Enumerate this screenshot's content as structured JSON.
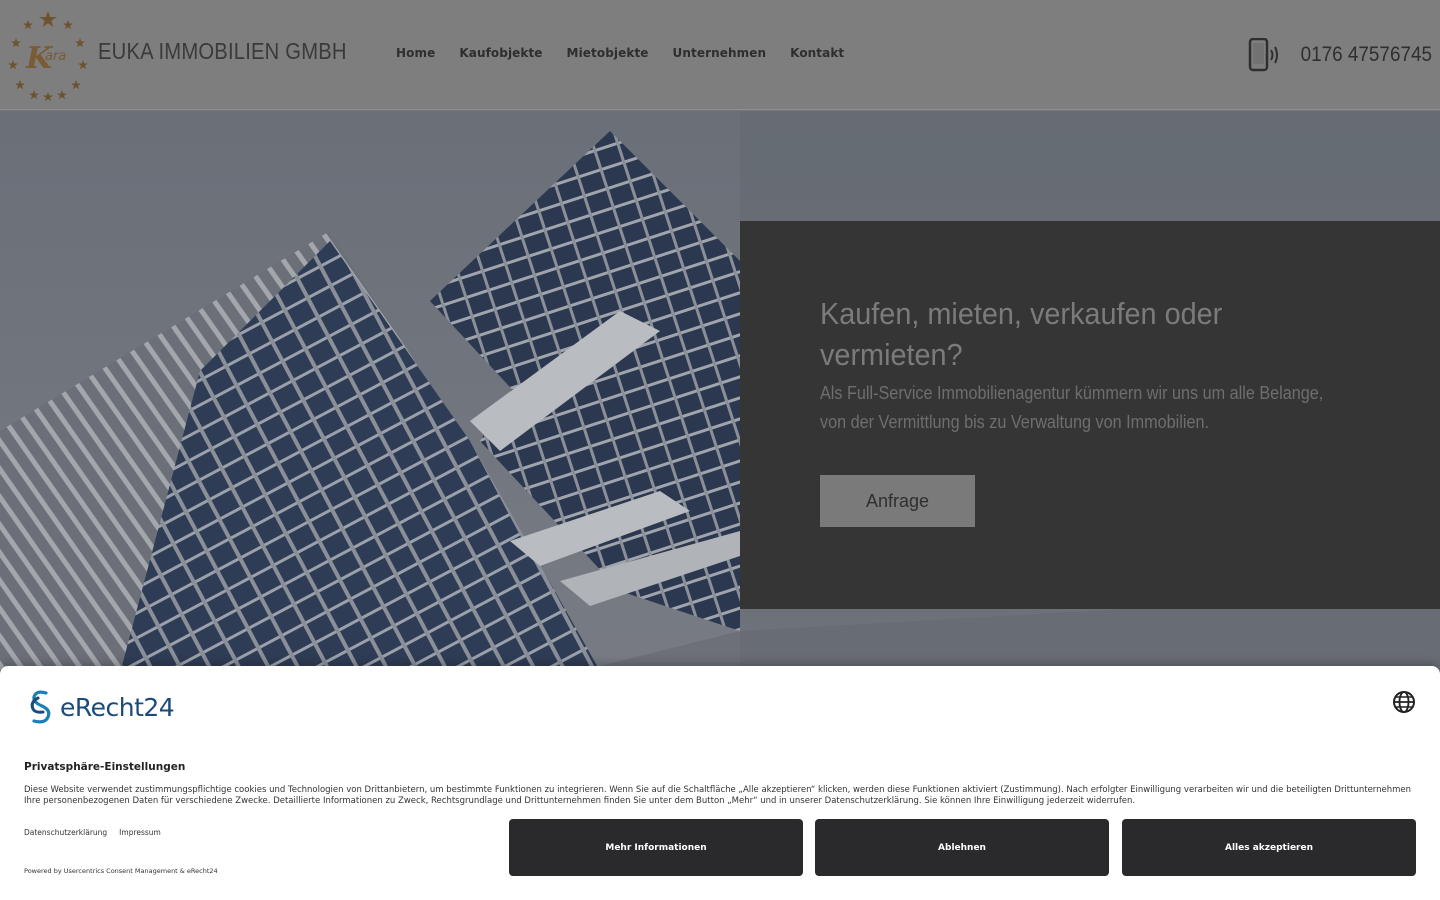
{
  "header": {
    "brand": "EUKA IMMOBILIEN GMBH",
    "logo_text": "Kara",
    "nav": [
      "Home",
      "Kaufobjekte",
      "Mietobjekte",
      "Unternehmen",
      "Kontakt"
    ],
    "phone": "0176 47576745"
  },
  "hero": {
    "title": "Kaufen, mieten, verkaufen oder vermieten?",
    "text": "Als Full-Service Immobilienagentur kümmern wir uns um alle Belange, von der Vermittlung bis zu Verwaltung von Immobilien.",
    "button": "Anfrage"
  },
  "consent": {
    "logo_text": "eRecht24",
    "title": "Privatsphäre-Einstellungen",
    "text": "Diese Website verwendet zustimmungspflichtige cookies und Technologien von Drittanbietern, um bestimmte Funktionen zu integrieren. Wenn Sie auf die Schaltfläche „Alle akzeptieren“ klicken, werden diese Funktionen aktiviert (Zustimmung). Nach erfolgter Einwilligung verarbeiten wir und die beteiligten Drittunternehmen Ihre personenbezogenen Daten für verschiedene Zwecke. Detaillierte Informationen zu Zweck, Rechtsgrundlage und Drittunternehmen finden Sie unter dem Button „Mehr“ und in unserer Datenschutzerklärung. Sie können Ihre Einwilligung jederzeit widerrufen.",
    "links": [
      "Datenschutzerklärung",
      "Impressum"
    ],
    "powered": "Powered by Usercentrics Consent Management & eRecht24",
    "buttons": {
      "more": "Mehr Informationen",
      "deny": "Ablehnen",
      "accept": "Alles akzeptieren"
    }
  },
  "icons": {
    "logo": "star-wreath-logo",
    "phone": "smartphone-icon",
    "language": "globe-icon"
  },
  "colors": {
    "logo_gold": "#8a6a3a",
    "consent_brand": "#1a4b7a",
    "consent_button": "#2a2a2c"
  }
}
